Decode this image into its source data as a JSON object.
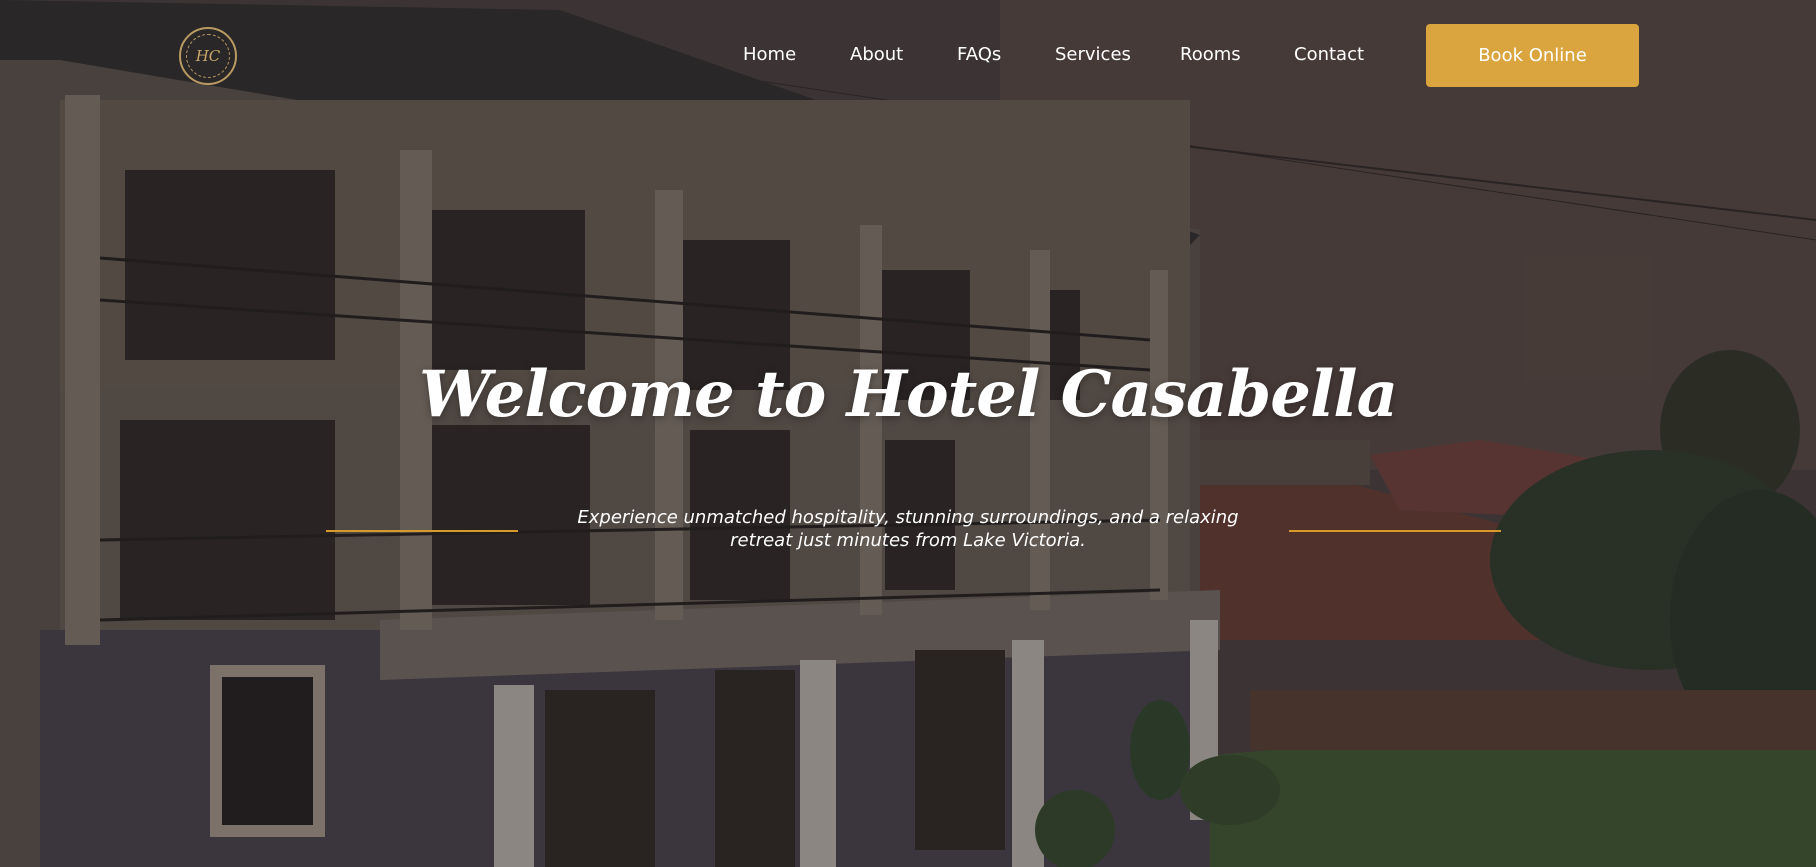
{
  "logo": {
    "monogram": "HC"
  },
  "nav": {
    "items": [
      {
        "label": "Home"
      },
      {
        "label": "About"
      },
      {
        "label": "FAQs"
      },
      {
        "label": "Services"
      },
      {
        "label": "Rooms"
      },
      {
        "label": "Contact"
      }
    ],
    "cta_label": "Book Online"
  },
  "hero": {
    "title": "Welcome to Hotel Casabella",
    "subtitle": "Experience unmatched hospitality, stunning surroundings, and a relaxing retreat just minutes from Lake Victoria."
  },
  "colors": {
    "accent": "#daa53e",
    "rule": "#d59a2a",
    "text": "#ffffff",
    "overlay": "#282222"
  }
}
